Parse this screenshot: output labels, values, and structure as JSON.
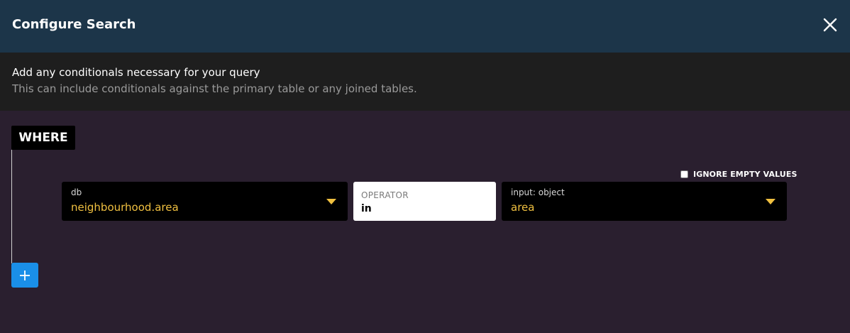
{
  "header": {
    "title": "Configure Search",
    "close_icon": "close-icon"
  },
  "description": {
    "main": "Add any conditionals necessary for your query",
    "sub": "This can include conditionals against the primary table or any joined tables."
  },
  "where": {
    "label": "WHERE"
  },
  "condition": {
    "ignore_empty": {
      "label": "IGNORE EMPTY VALUES",
      "checked": false
    },
    "left": {
      "label": "db",
      "value": "neighbourhood.area"
    },
    "operator": {
      "label": "OPERATOR",
      "value": "in"
    },
    "right": {
      "label": "input: object",
      "value": "area"
    }
  },
  "add_button": {
    "icon": "plus-icon"
  },
  "colors": {
    "header_bg": "#1c3549",
    "desc_bg": "#1e1e1e",
    "body_bg": "#2a1f2f",
    "accent_yellow": "#f0c040",
    "add_blue": "#1a8fe8"
  }
}
